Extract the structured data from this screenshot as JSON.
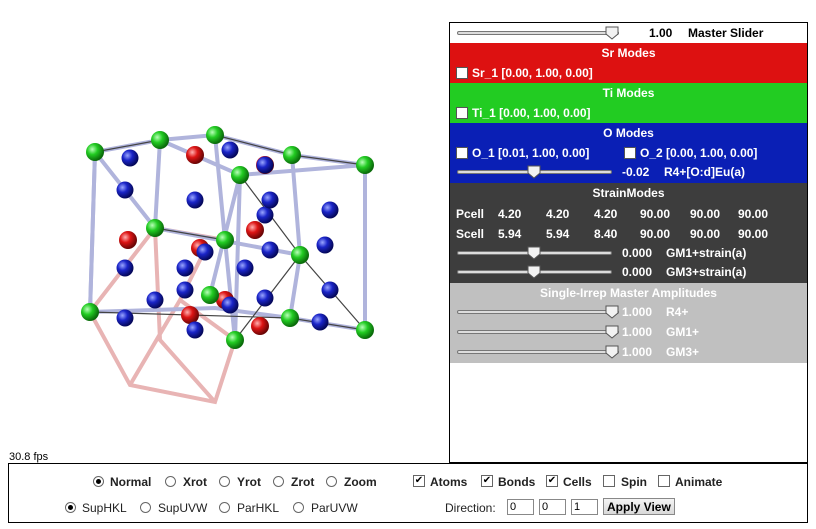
{
  "viewer": {
    "fps": "30.8 fps"
  },
  "panel": {
    "master": {
      "value": "1.00",
      "label": "Master Slider",
      "level": 0.85
    },
    "sr": {
      "header": "Sr Modes",
      "item": "Sr_1 [0.00, 1.00, 0.00]",
      "color": "#dd1111"
    },
    "ti": {
      "header": "Ti Modes",
      "item": "Ti_1 [0.00, 1.00, 0.00]",
      "color": "#22cc22"
    },
    "o": {
      "header": "O Modes",
      "color": "#0a1fb5",
      "item1": "O_1 [0.01, 1.00, 0.00]",
      "item2": "O_2 [0.00, 1.00, 0.00]",
      "mode_value": "-0.02",
      "mode_label": "R4+[O:d]Eu(a)",
      "mode_level": 0.5
    },
    "strain": {
      "header": "StrainModes",
      "color": "#3d3d3d",
      "pcell_label": "Pcell",
      "pcell": [
        "4.20",
        "4.20",
        "4.20",
        "90.00",
        "90.00",
        "90.00"
      ],
      "scell_label": "Scell",
      "scell": [
        "5.94",
        "5.94",
        "8.40",
        "90.00",
        "90.00",
        "90.00"
      ],
      "mode1_value": "0.000",
      "mode1_label": "GM1+strain(a)",
      "mode1_level": 0.5,
      "mode2_value": "0.000",
      "mode2_label": "GM3+strain(a)",
      "mode2_level": 0.5
    },
    "irrep": {
      "header": "Single-Irrep Master Amplitudes",
      "color": "#c0c0c0",
      "rows": [
        {
          "value": "1.000",
          "label": "R4+",
          "level": 1.0
        },
        {
          "value": "1.000",
          "label": "GM1+",
          "level": 1.0
        },
        {
          "value": "1.000",
          "label": "GM3+",
          "level": 1.0
        }
      ]
    }
  },
  "controls": {
    "view_modes": [
      "Normal",
      "Xrot",
      "Yrot",
      "Zrot",
      "Zoom"
    ],
    "view_selected": "Normal",
    "toggles": [
      {
        "label": "Atoms",
        "checked": true
      },
      {
        "label": "Bonds",
        "checked": true
      },
      {
        "label": "Cells",
        "checked": true
      },
      {
        "label": "Spin",
        "checked": false
      },
      {
        "label": "Animate",
        "checked": false
      }
    ],
    "hkl_modes": [
      "SupHKL",
      "SupUVW",
      "ParHKL",
      "ParUVW"
    ],
    "hkl_selected": "SupHKL",
    "direction_label": "Direction:",
    "direction": [
      "0",
      "0",
      "1"
    ],
    "apply_label": "Apply View"
  }
}
